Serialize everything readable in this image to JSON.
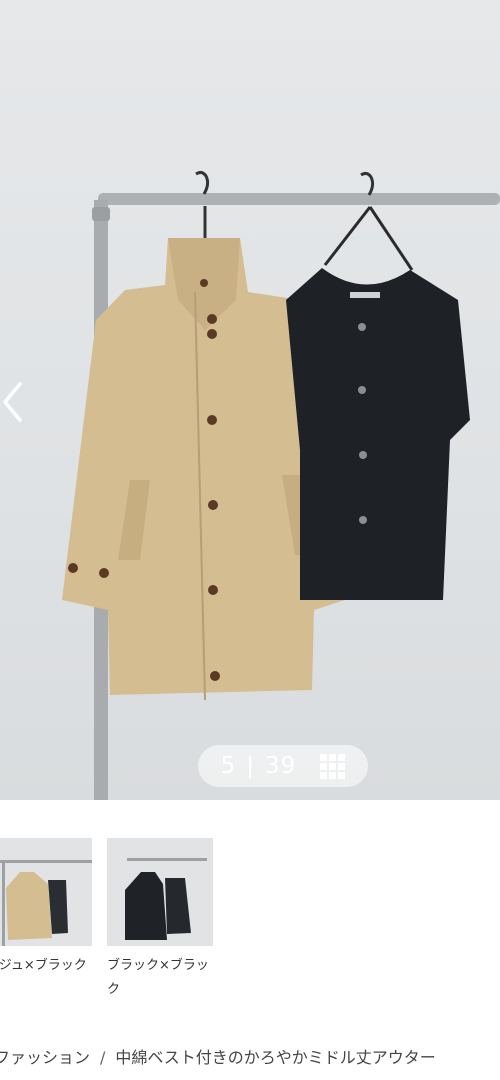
{
  "gallery": {
    "counter": {
      "current": "5",
      "separator": "|",
      "total": "39"
    },
    "prev_icon": "chevron-left-icon",
    "grid_icon": "grid-icon"
  },
  "variants": [
    {
      "label": "ージュ×ブラック",
      "name": "beige-black"
    },
    {
      "label": "ブラック×ブラック",
      "name": "black-black"
    }
  ],
  "breadcrumb": {
    "items": [
      "ファッション",
      "中綿ベスト付きのかろやかミドル丈アウター"
    ],
    "separator": "/"
  },
  "colors": {
    "coat": "#d6bf93",
    "vest": "#1e2226",
    "rail": "#a7aaad"
  }
}
